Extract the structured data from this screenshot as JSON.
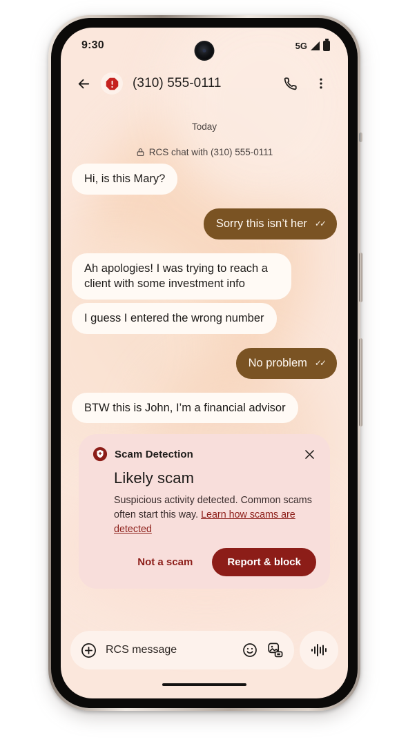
{
  "status_bar": {
    "clock": "9:30",
    "network": "5G",
    "signal_icon": "signal-bars-icon",
    "battery_icon": "battery-full-icon"
  },
  "app_bar": {
    "back_icon": "back-arrow-icon",
    "warning_icon": "scam-warning-octagon-icon",
    "contact": "(310) 555-0111",
    "call_icon": "phone-call-icon",
    "overflow_icon": "more-vertical-icon"
  },
  "thread": {
    "day_label": "Today",
    "lock_icon": "lock-icon",
    "rcs_note": "RCS chat with (310) 555-0111",
    "read_ticks": "✓✓",
    "messages": [
      {
        "side": "in",
        "text": "Hi, is this Mary?"
      },
      {
        "side": "out",
        "text": "Sorry this isn’t her"
      },
      {
        "side": "in",
        "text": "Ah apologies! I was trying to reach a client with some investment info"
      },
      {
        "side": "in",
        "text": "I guess I entered the wrong number"
      },
      {
        "side": "out",
        "text": "No problem"
      },
      {
        "side": "in",
        "text": "BTW this is John, I’m a financial advisor"
      }
    ]
  },
  "scam_card": {
    "shield_icon": "scam-detection-shield-icon",
    "brand": "Scam Detection",
    "close_icon": "close-icon",
    "title": "Likely scam",
    "body_text": "Suspicious activity detected. Common scams often start this way. ",
    "link_text": "Learn how scams are detected",
    "not_a_scam_label": "Not a scam",
    "report_block_label": "Report & block"
  },
  "composer": {
    "plus_icon": "add-attachment-icon",
    "placeholder": "RCS message",
    "emoji_icon": "emoji-smiley-icon",
    "gallery_icon": "gallery-camera-icon",
    "mic_icon": "voice-waveform-icon"
  },
  "colors": {
    "screen_background": "#fbe7dc",
    "incoming_bubble": "#fffaf5",
    "outgoing_bubble": "#7a5323",
    "card_background": "#f8dedb",
    "danger": "#8c1d18",
    "warning_red": "#c5221f",
    "text_primary": "#1d1b19"
  }
}
